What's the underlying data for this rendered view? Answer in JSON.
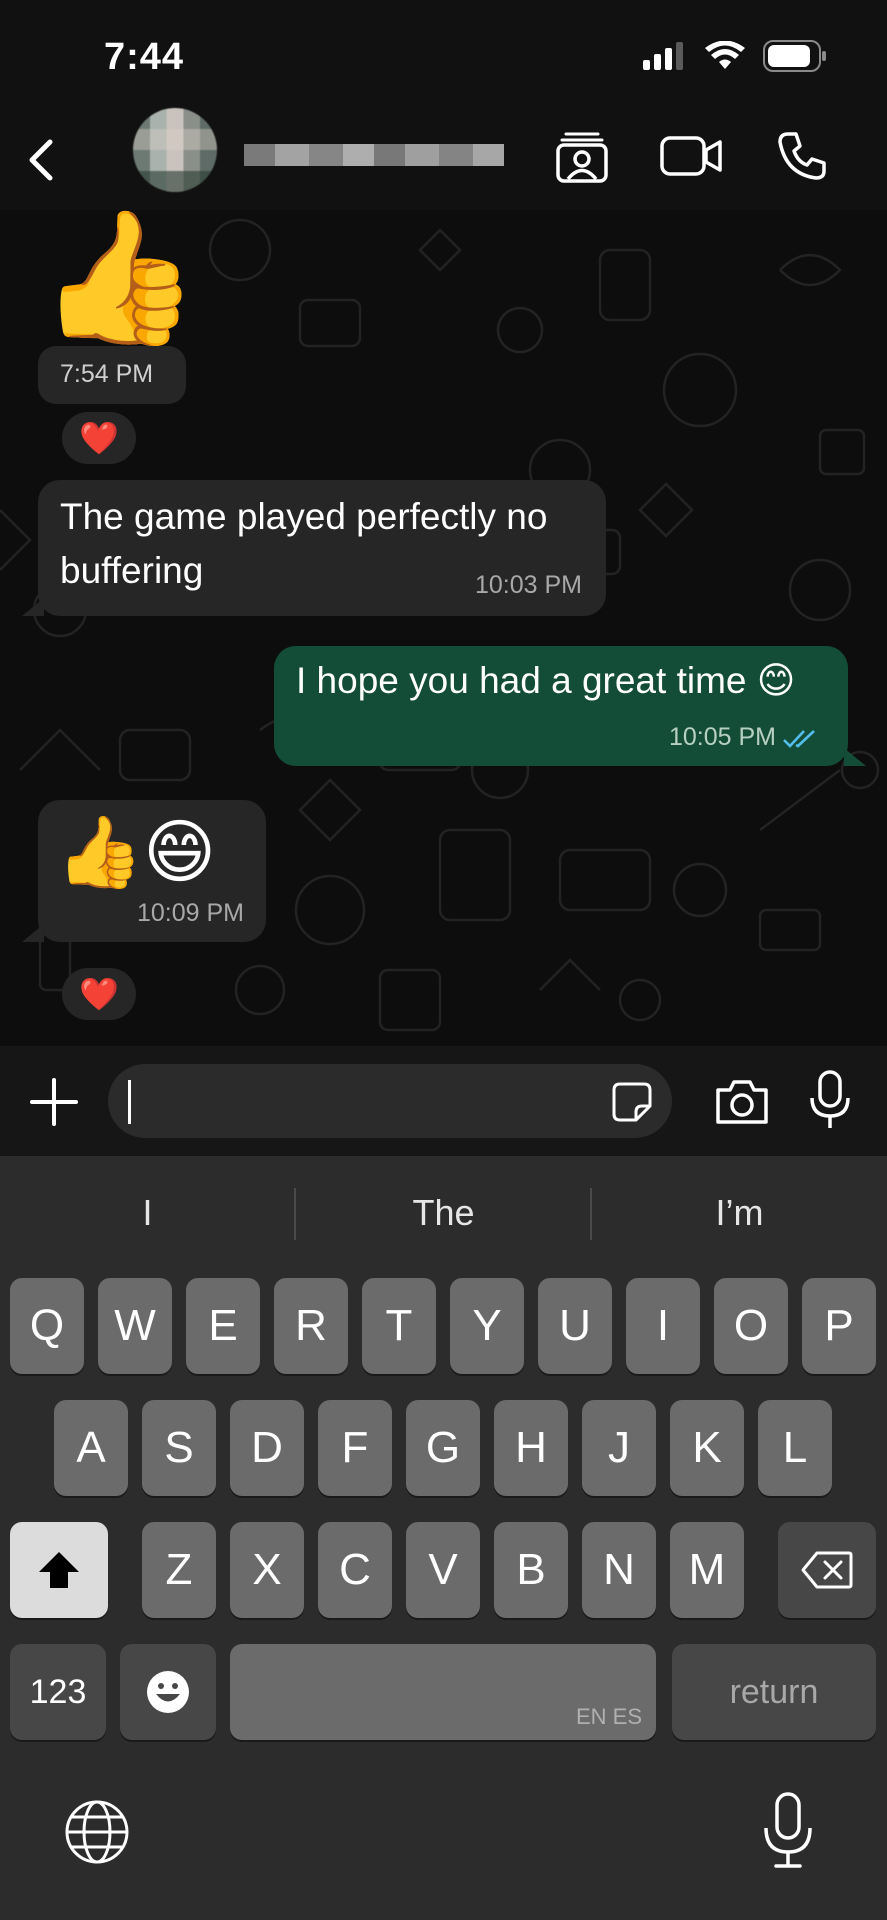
{
  "status_bar": {
    "time": "7:44"
  },
  "header": {
    "contact_name_blurred": true
  },
  "messages": [
    {
      "direction": "incoming",
      "type": "emoji",
      "content": "👍",
      "time": "7:54 PM",
      "reaction": "❤️"
    },
    {
      "direction": "incoming",
      "type": "text",
      "content_line1": "The game played perfectly no",
      "content_line2": "buffering",
      "time": "10:03 PM"
    },
    {
      "direction": "outgoing",
      "type": "text",
      "content": "I hope you had a great time 😊",
      "time": "10:05 PM",
      "status": "read"
    },
    {
      "direction": "incoming",
      "type": "emoji",
      "content": "👍😄",
      "time": "10:09 PM",
      "reaction": "❤️"
    }
  ],
  "input": {
    "value": ""
  },
  "keyboard": {
    "suggestions": [
      "I",
      "The",
      "I’m"
    ],
    "row1": [
      "Q",
      "W",
      "E",
      "R",
      "T",
      "Y",
      "U",
      "I",
      "O",
      "P"
    ],
    "row2": [
      "A",
      "S",
      "D",
      "F",
      "G",
      "H",
      "J",
      "K",
      "L"
    ],
    "row3": [
      "Z",
      "X",
      "C",
      "V",
      "B",
      "N",
      "M"
    ],
    "numbers_label": "123",
    "space_language": "EN ES",
    "return_label": "return"
  },
  "colors": {
    "outgoing_bubble": "#144d37",
    "incoming_bubble": "#262626",
    "read_ticks": "#53bdeb"
  }
}
